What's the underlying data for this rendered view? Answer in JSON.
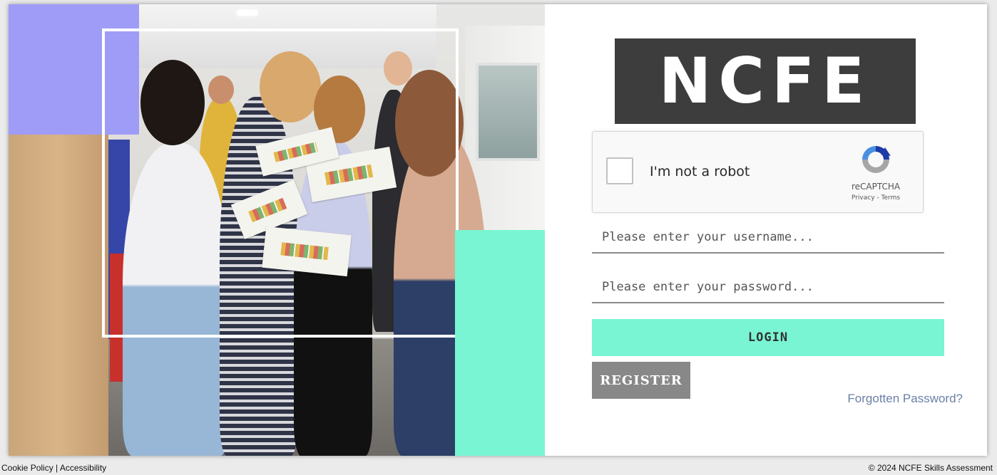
{
  "brand": {
    "logo_text": "NCFE"
  },
  "recaptcha": {
    "checkbox_label": "I'm not a robot",
    "brand_label": "reCAPTCHA",
    "privacy_label": "Privacy",
    "separator": " - ",
    "terms_label": "Terms",
    "icon": "recaptcha-icon"
  },
  "login_form": {
    "username_placeholder": "Please enter your username...",
    "password_placeholder": "Please enter your password...",
    "login_label": "LOGIN",
    "register_label": "REGISTER",
    "forgot_label": "Forgotten Password?"
  },
  "footer": {
    "cookie_policy": "Cookie Policy",
    "separator": " | ",
    "accessibility": "Accessibility",
    "copyright": "© 2024 NCFE Skills Assessment"
  },
  "colors": {
    "accent_teal": "#79f5d3",
    "accent_purple": "#9f9cf7",
    "logo_dark": "#3d3d3d",
    "register_gray": "#888888",
    "link_blue": "#6b7fa6"
  }
}
